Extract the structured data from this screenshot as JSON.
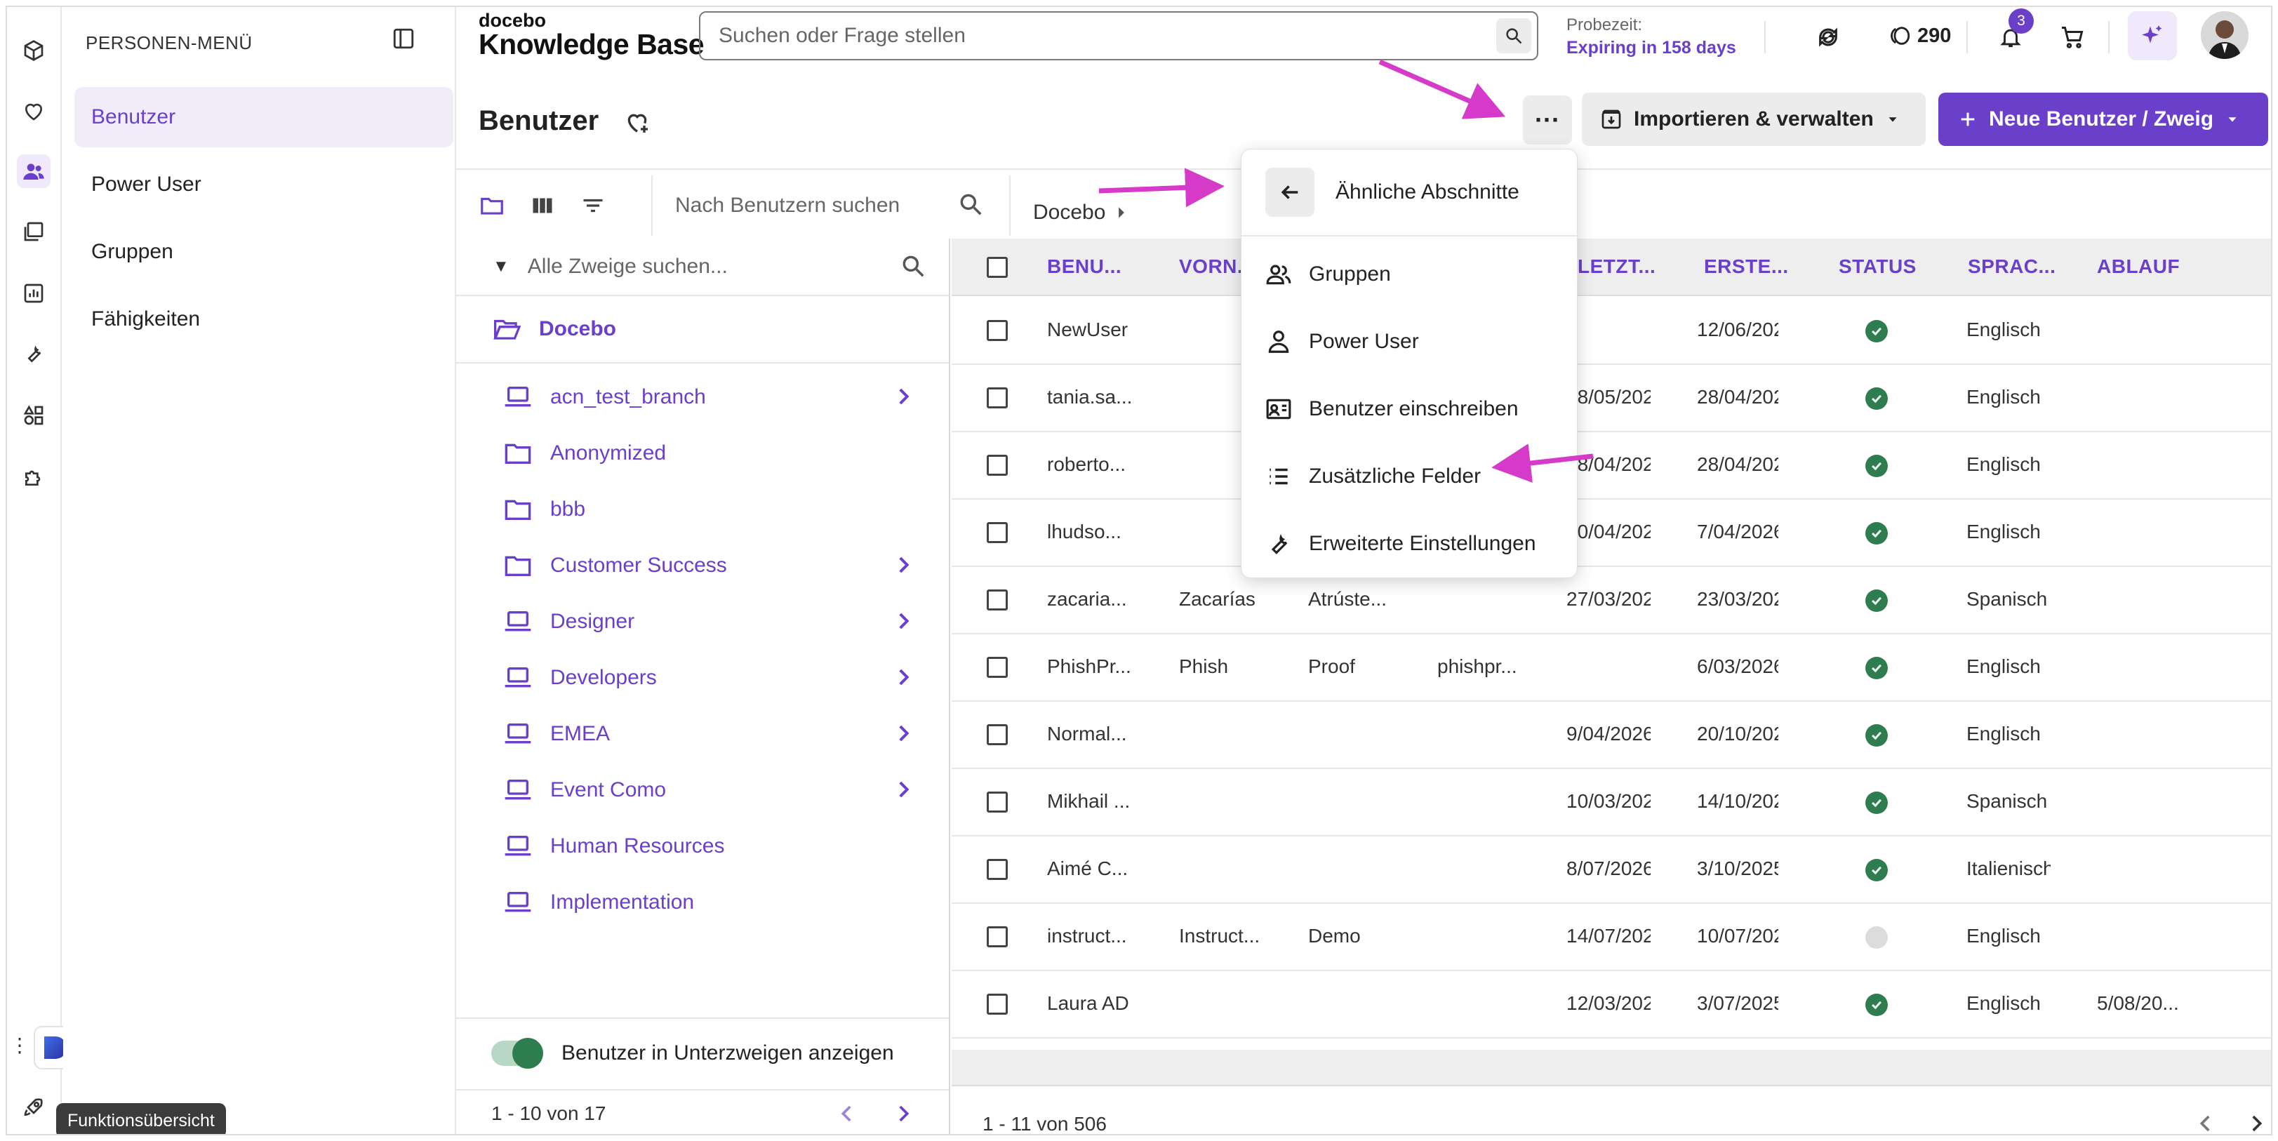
{
  "header": {
    "brand_small": "docebo",
    "brand_title": "Knowledge Base",
    "search_placeholder": "Suchen oder Frage stellen",
    "trial_label": "Probezeit:",
    "trial_value": "Expiring in 158 days",
    "coins": "290",
    "notifications_count": "3"
  },
  "sidebar": {
    "title": "PERSONEN-MENÜ",
    "items": [
      {
        "label": "Benutzer"
      },
      {
        "label": "Power User"
      },
      {
        "label": "Gruppen"
      },
      {
        "label": "Fähigkeiten"
      }
    ],
    "tooltip": "Funktionsübersicht"
  },
  "page": {
    "title": "Benutzer",
    "import_label": "Importieren & verwalten",
    "new_label": "Neue Benutzer / Zweig",
    "user_search_placeholder": "Nach Benutzern suchen",
    "breadcrumb": "Docebo"
  },
  "branches": {
    "search_placeholder": "Alle Zweige suchen...",
    "root": "Docebo",
    "items": [
      {
        "label": "acn_test_branch",
        "icon": "laptop-icon",
        "children": true
      },
      {
        "label": "Anonymized",
        "icon": "folder-icon",
        "children": false
      },
      {
        "label": "bbb",
        "icon": "folder-icon",
        "children": false
      },
      {
        "label": "Customer Success",
        "icon": "folder-icon",
        "children": true
      },
      {
        "label": "Designer",
        "icon": "laptop-icon",
        "children": true
      },
      {
        "label": "Developers",
        "icon": "laptop-icon",
        "children": true
      },
      {
        "label": "EMEA",
        "icon": "laptop-icon",
        "children": true
      },
      {
        "label": "Event Como",
        "icon": "laptop-icon",
        "children": true
      },
      {
        "label": "Human Resources",
        "icon": "laptop-icon",
        "children": false
      },
      {
        "label": "Implementation",
        "icon": "laptop-icon",
        "children": false
      }
    ],
    "toggle_label": "Benutzer in Unterzweigen anzeigen",
    "pagination": "1 - 10 von 17"
  },
  "table": {
    "columns": [
      "BENU...",
      "VORN...",
      "LETZT...",
      "ERSTE...",
      "STATUS",
      "SPRAC...",
      "ABLAUF"
    ],
    "rows": [
      {
        "user": "NewUser",
        "first": "",
        "last": "",
        "email": "",
        "last_login": "",
        "created": "12/06/202",
        "active": true,
        "lang": "Englisch",
        "expiry": ""
      },
      {
        "user": "tania.sa...",
        "first": "",
        "last": "",
        "email": "",
        "last_login": "18/05/202",
        "created": "28/04/202",
        "active": true,
        "lang": "Englisch",
        "expiry": ""
      },
      {
        "user": "roberto...",
        "first": "",
        "last": "",
        "email": "",
        "last_login": "28/04/202",
        "created": "28/04/202",
        "active": true,
        "lang": "Englisch",
        "expiry": ""
      },
      {
        "user": "lhudso...",
        "first": "",
        "last": "",
        "email": "",
        "last_login": "10/04/202",
        "created": "7/04/2026",
        "active": true,
        "lang": "Englisch",
        "expiry": ""
      },
      {
        "user": "zacaria...",
        "first": "Zacarías",
        "last": "Atrúste...",
        "email": "",
        "last_login": "27/03/202",
        "created": "23/03/202",
        "active": true,
        "lang": "Spanisch",
        "expiry": ""
      },
      {
        "user": "PhishPr...",
        "first": "Phish",
        "last": "Proof",
        "email": "phishpr...",
        "last_login": "",
        "created": "6/03/2026",
        "active": true,
        "lang": "Englisch",
        "expiry": ""
      },
      {
        "user": "Normal...",
        "first": "",
        "last": "",
        "email": "",
        "last_login": "9/04/2026",
        "created": "20/10/202",
        "active": true,
        "lang": "Englisch",
        "expiry": ""
      },
      {
        "user": "Mikhail ...",
        "first": "",
        "last": "",
        "email": "",
        "last_login": "10/03/202",
        "created": "14/10/202",
        "active": true,
        "lang": "Spanisch",
        "expiry": ""
      },
      {
        "user": "Aimé C...",
        "first": "",
        "last": "",
        "email": "",
        "last_login": "8/07/2026",
        "created": "3/10/2025",
        "active": true,
        "lang": "Italienisch",
        "expiry": ""
      },
      {
        "user": "instruct...",
        "first": "Instruct...",
        "last": "Demo",
        "email": "",
        "last_login": "14/07/202",
        "created": "10/07/202",
        "active": false,
        "lang": "Englisch",
        "expiry": ""
      },
      {
        "user": "Laura AD",
        "first": "",
        "last": "",
        "email": "",
        "last_login": "12/03/202",
        "created": "3/07/2025",
        "active": true,
        "lang": "Englisch",
        "expiry": "5/08/20..."
      }
    ],
    "pagination": "1 - 11 von 506"
  },
  "dropdown": {
    "back_label": "Ähnliche Abschnitte",
    "items": [
      {
        "label": "Gruppen",
        "icon": "group-icon"
      },
      {
        "label": "Power User",
        "icon": "person-icon"
      },
      {
        "label": "Benutzer einschreiben",
        "icon": "enroll-icon"
      },
      {
        "label": "Zusätzliche Felder",
        "icon": "list-icon"
      },
      {
        "label": "Erweiterte Einstellungen",
        "icon": "wrench-icon"
      }
    ]
  },
  "colors": {
    "accent": "#6a3fc9",
    "status_active": "#2e7d4f",
    "annotation_arrow": "#d63ac9"
  }
}
